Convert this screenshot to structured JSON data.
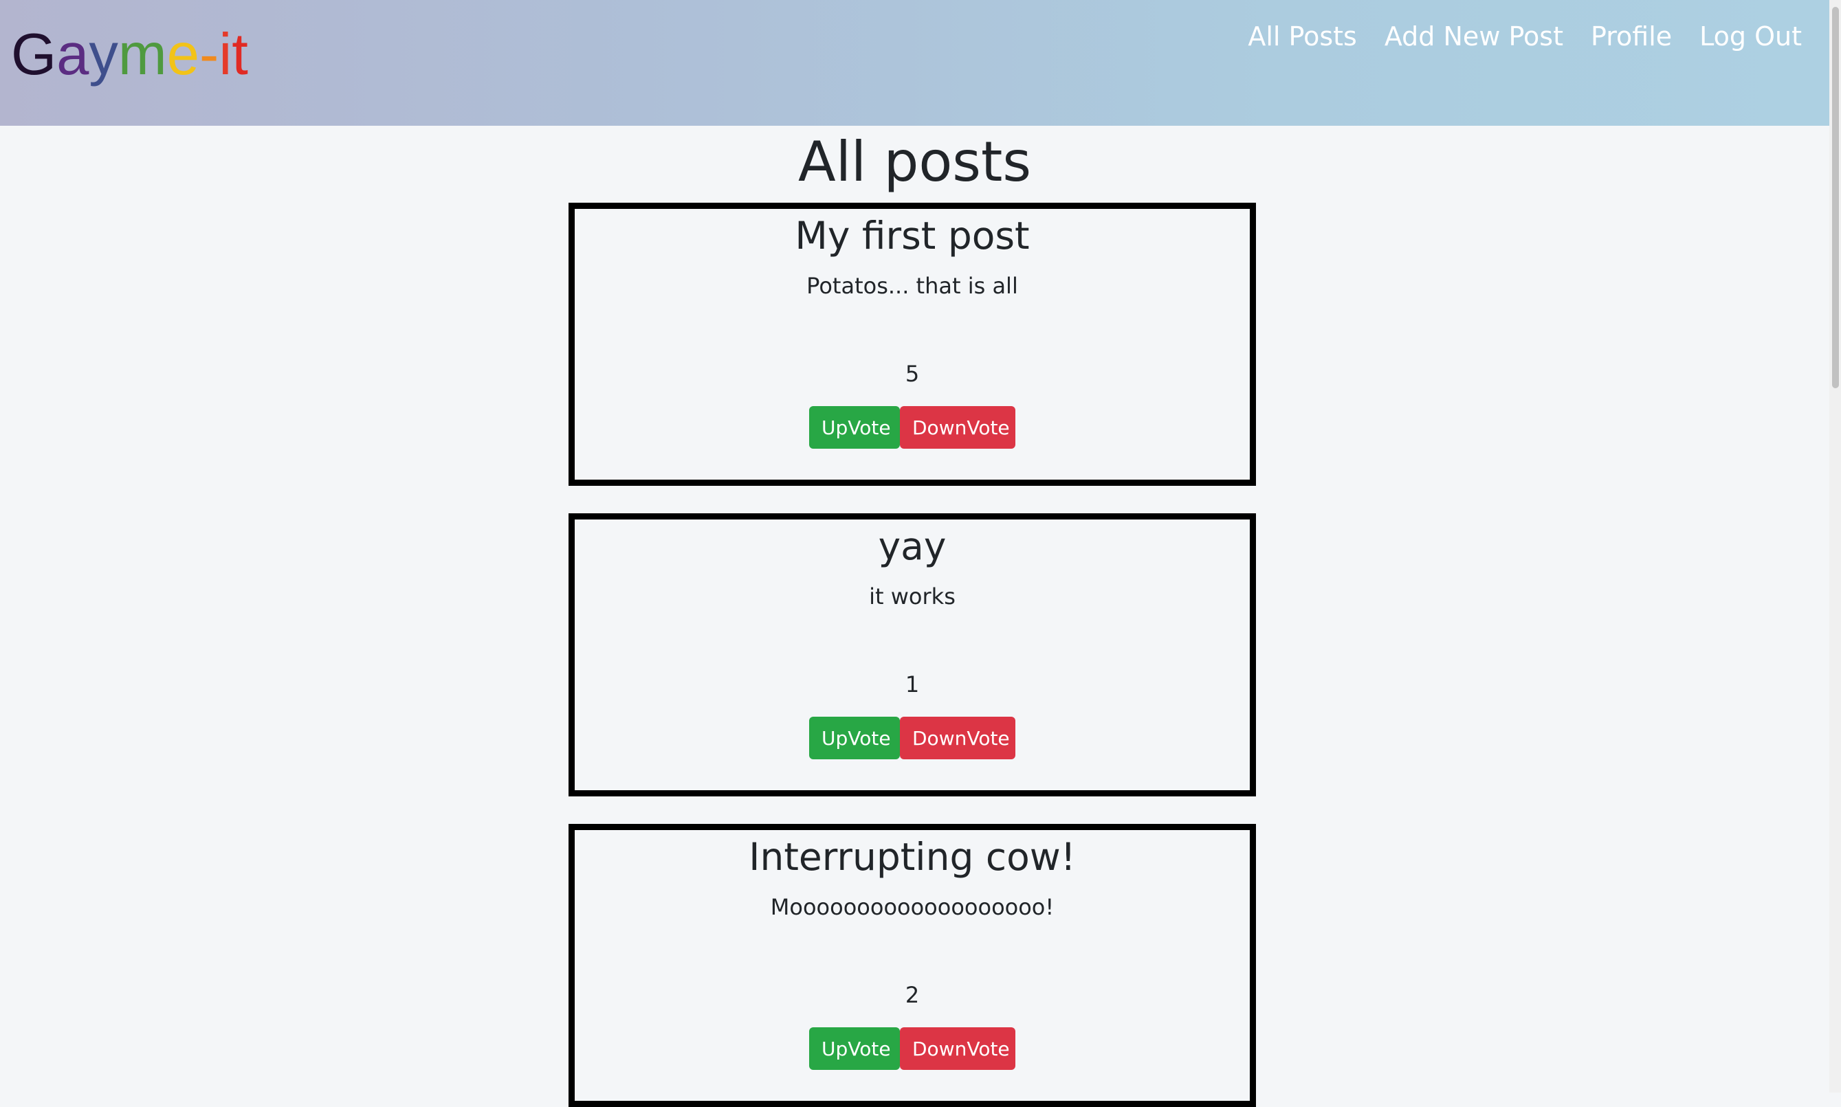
{
  "header": {
    "logo_letters": [
      {
        "char": "G",
        "color": "#1f0f2e"
      },
      {
        "char": "a",
        "color": "#5b2d82"
      },
      {
        "char": "y",
        "color": "#3f4f8c"
      },
      {
        "char": "m",
        "color": "#4f9a3f"
      },
      {
        "char": "e",
        "color": "#f2c318"
      },
      {
        "char": "-",
        "color": "#f08a1e"
      },
      {
        "char": "i",
        "color": "#e53a2a"
      },
      {
        "char": "t",
        "color": "#e02a24"
      }
    ],
    "nav": {
      "all_posts": "All Posts",
      "add_new_post": "Add New Post",
      "profile": "Profile",
      "log_out": "Log Out"
    }
  },
  "main": {
    "title": "All posts",
    "posts": [
      {
        "title": "My first post",
        "body": "Potatos... that is all",
        "votes": "5",
        "upvote_label": "UpVote",
        "downvote_label": "DownVote"
      },
      {
        "title": "yay",
        "body": "it works",
        "votes": "1",
        "upvote_label": "UpVote",
        "downvote_label": "DownVote"
      },
      {
        "title": "Interrupting cow!",
        "body": "Mooooooooooooooooooo!",
        "votes": "2",
        "upvote_label": "UpVote",
        "downvote_label": "DownVote"
      }
    ]
  },
  "colors": {
    "upvote": "#28a745",
    "downvote": "#dc3545"
  }
}
